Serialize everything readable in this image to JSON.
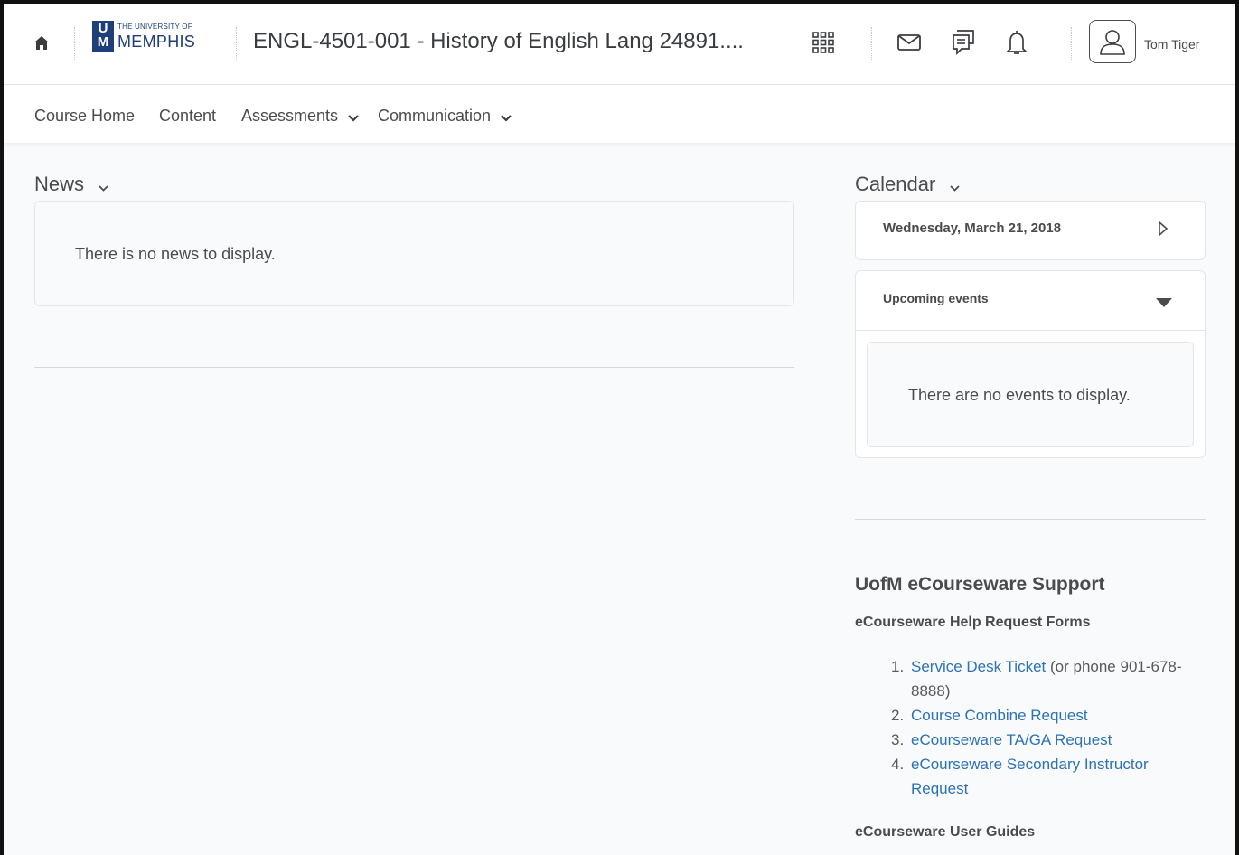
{
  "header": {
    "logo_small": "THE UNIVERSITY OF",
    "logo_big": "MEMPHIS",
    "logo_mark": "UM",
    "course_title": "ENGL-4501-001 - History of English Lang 24891....",
    "user_name": "Tom Tiger",
    "icons": [
      "home-icon",
      "grid-icon",
      "mail-icon",
      "chat-icon",
      "bell-icon",
      "user-avatar-icon"
    ]
  },
  "nav": {
    "items": [
      {
        "label": "Course Home",
        "dropdown": false
      },
      {
        "label": "Content",
        "dropdown": false
      },
      {
        "label": "Assessments",
        "dropdown": true
      },
      {
        "label": "Communication",
        "dropdown": true
      }
    ]
  },
  "news": {
    "title": "News",
    "empty_message": "There is no news to display."
  },
  "calendar": {
    "title": "Calendar",
    "date": "Wednesday, March 21, 2018",
    "upcoming_label": "Upcoming events",
    "empty_message": "There are no events to display."
  },
  "support": {
    "title": "UofM eCourseware Support",
    "forms_heading": "eCourseware Help Request Forms",
    "items": [
      {
        "num": "1.",
        "link": "Service Desk Ticket",
        "extra": " (or phone 901-678-8888)"
      },
      {
        "num": "2.",
        "link": "Course Combine Request",
        "extra": ""
      },
      {
        "num": "3.",
        "link": "eCourseware TA/GA Request",
        "extra": ""
      },
      {
        "num": "4.",
        "link": "eCourseware Secondary Instructor Request",
        "extra": ""
      }
    ],
    "guides_heading": "eCourseware User Guides"
  },
  "colors": {
    "link": "#2c72b5",
    "brand": "#1f3f7a",
    "text": "#494c4e"
  }
}
